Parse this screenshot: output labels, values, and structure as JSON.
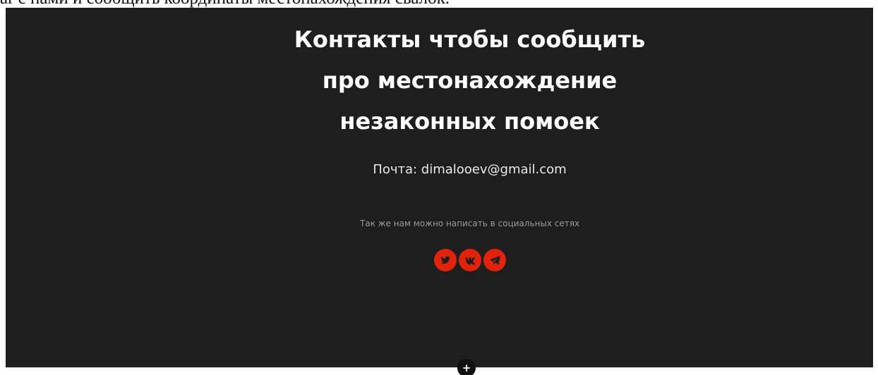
{
  "top_text": "ar с нами и сообщить координаты местонахождения свалок.",
  "contacts": {
    "heading_lines": [
      "Контакты чтобы сообщить",
      "про местонахождение",
      "незаконных помоек"
    ],
    "email_text": "Почта: dimalooev@gmail.com",
    "social_note": "Так же нам можно написать в социальных сетях",
    "social_links": [
      {
        "icon": "twitter-icon"
      },
      {
        "icon": "vk-icon"
      },
      {
        "icon": "telegram-icon"
      }
    ],
    "accent_color": "#e0230a",
    "background_color": "#1e1e1e"
  },
  "add_block": {
    "label": "+"
  }
}
